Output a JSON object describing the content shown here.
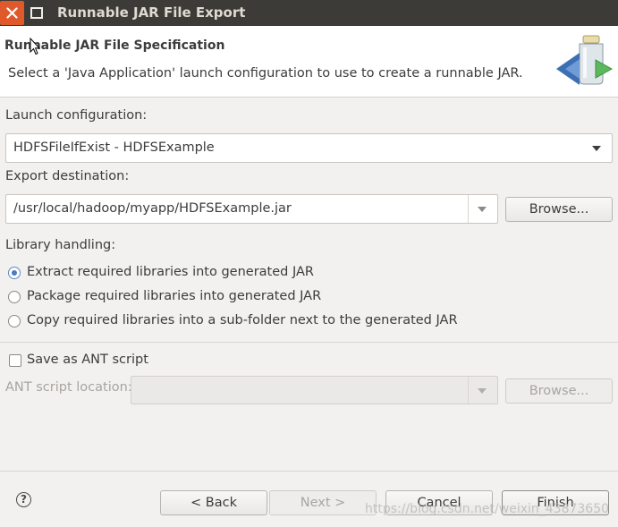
{
  "window": {
    "title": "Runnable JAR File Export"
  },
  "header": {
    "title": "Runnable JAR File Specification",
    "description": "Select a 'Java Application' launch configuration to use to create a runnable JAR."
  },
  "launch": {
    "label": "Launch configuration:",
    "value": "HDFSFileIfExist - HDFSExample"
  },
  "export": {
    "label": "Export destination:",
    "value": "/usr/local/hadoop/myapp/HDFSExample.jar",
    "browse_label": "Browse..."
  },
  "library": {
    "label": "Library handling:",
    "options": [
      {
        "label": "Extract required libraries into generated JAR",
        "selected": true
      },
      {
        "label": "Package required libraries into generated JAR",
        "selected": false
      },
      {
        "label": "Copy required libraries into a sub-folder next to the generated JAR",
        "selected": false
      }
    ]
  },
  "ant": {
    "save_label": "Save as ANT script",
    "checked": false,
    "location_label": "ANT script location:",
    "location_value": "",
    "browse_label": "Browse..."
  },
  "footer": {
    "help_icon": "?",
    "back_label": "< Back",
    "next_label": "Next >",
    "cancel_label": "Cancel",
    "finish_label": "Finish"
  },
  "watermark": "https://blog.csdn.net/weixin_43873650"
}
